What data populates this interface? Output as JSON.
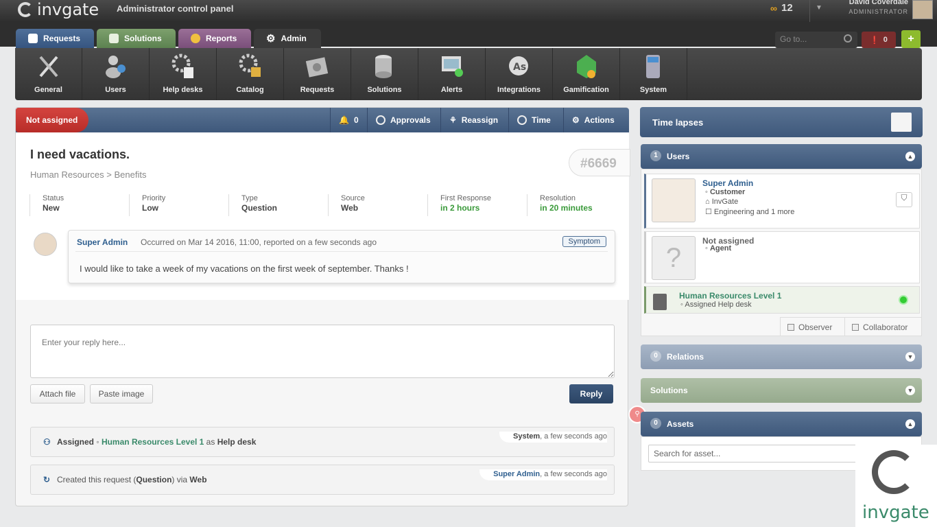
{
  "app": {
    "brand": "invgate",
    "subtitle": "Administrator control panel",
    "points": "12",
    "user_name": "David Coverdale",
    "user_role": "ADMINISTRATOR"
  },
  "tabs": [
    {
      "label": "Requests"
    },
    {
      "label": "Solutions"
    },
    {
      "label": "Reports"
    },
    {
      "label": "Admin"
    }
  ],
  "topright": {
    "goto_placeholder": "Go to...",
    "alerts_count": "0"
  },
  "admin_items": [
    {
      "label": "General",
      "icon": "tools-icon"
    },
    {
      "label": "Users",
      "icon": "users-icon"
    },
    {
      "label": "Help desks",
      "icon": "helpdesk-gear-icon"
    },
    {
      "label": "Catalog",
      "icon": "catalog-gear-icon"
    },
    {
      "label": "Requests",
      "icon": "requests-gear-icon"
    },
    {
      "label": "Solutions",
      "icon": "database-icon"
    },
    {
      "label": "Alerts",
      "icon": "alerts-icon"
    },
    {
      "label": "Integrations",
      "icon": "integrations-icon"
    },
    {
      "label": "Gamification",
      "icon": "gamification-icon"
    },
    {
      "label": "System",
      "icon": "system-icon"
    }
  ],
  "request": {
    "status_badge": "Not assigned",
    "toolbar": {
      "bell_count": "0",
      "approvals": "Approvals",
      "reassign": "Reassign",
      "time": "Time",
      "actions": "Actions"
    },
    "title": "I need vacations.",
    "category": "Human Resources > Benefits",
    "number": "#6669",
    "props": [
      {
        "k": "Status",
        "v": "New"
      },
      {
        "k": "Priority",
        "v": "Low"
      },
      {
        "k": "Type",
        "v": "Question"
      },
      {
        "k": "Source",
        "v": "Web"
      },
      {
        "k": "First Response",
        "v": "in 2 hours"
      },
      {
        "k": "Resolution",
        "v": "in 20 minutes"
      }
    ],
    "message": {
      "author": "Super Admin",
      "meta": "Occurred on Mar 14 2016, 11:00, reported on a few seconds ago",
      "tag": "Symptom",
      "body": "I would like to take a week of my vacations on the first week of september. Thanks !"
    },
    "reply_placeholder": "Enter your reply here...",
    "attach_file": "Attach file",
    "paste_image": "Paste image",
    "reply_button": "Reply",
    "history": [
      {
        "pre": "Assigned",
        "link": "Human Resources Level 1",
        "mid": " as ",
        "bold": "Help desk",
        "who": "System",
        "when": ", a few seconds ago"
      },
      {
        "pre": "Created this request (",
        "bold": "Question",
        "post": ") via ",
        "bold2": "Web",
        "who": "Super Admin",
        "when": ", a few seconds ago"
      }
    ]
  },
  "sidebar": {
    "time_lapses": "Time lapses",
    "users": {
      "count": "1",
      "label": "Users",
      "customer": {
        "name": "Super Admin",
        "role": "Customer",
        "company": "InvGate",
        "groups": "Engineering and 1 more"
      },
      "agent": {
        "name": "Not assigned",
        "role": "Agent"
      },
      "helpdesk": {
        "name": "Human Resources Level 1",
        "role": "Assigned Help desk"
      },
      "observer": "Observer",
      "collaborator": "Collaborator"
    },
    "relations": {
      "count": "0",
      "label": "Relations"
    },
    "solutions": {
      "label": "Solutions"
    },
    "assets": {
      "count": "0",
      "label": "Assets",
      "search_placeholder": "Search for asset..."
    }
  },
  "watermark": "invgate"
}
